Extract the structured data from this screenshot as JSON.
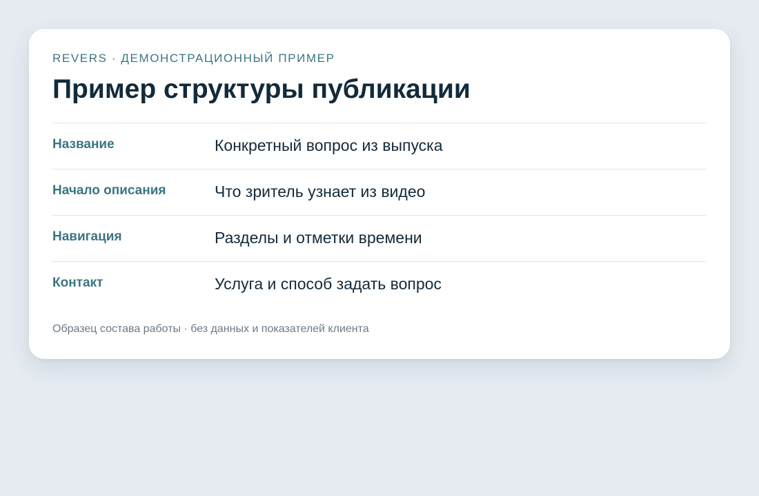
{
  "card": {
    "eyebrow": "REVERS · ДЕМОНСТРАЦИОННЫЙ ПРИМЕР",
    "title": "Пример структуры публикации",
    "rows": [
      {
        "label": "Название",
        "value": "Конкретный вопрос из выпуска"
      },
      {
        "label": "Начало описания",
        "value": "Что зритель узнает из видео"
      },
      {
        "label": "Навигация",
        "value": "Разделы и отметки времени"
      },
      {
        "label": "Контакт",
        "value": "Услуга и способ задать вопрос"
      }
    ],
    "footnote": "Образец состава работы · без данных и показателей клиента"
  },
  "colors": {
    "background": "#e6ebf2",
    "card": "#ffffff",
    "accent": "#3b7582",
    "heading": "#132a3a",
    "muted": "#6b7a86",
    "divider": "#dfe5eb"
  }
}
